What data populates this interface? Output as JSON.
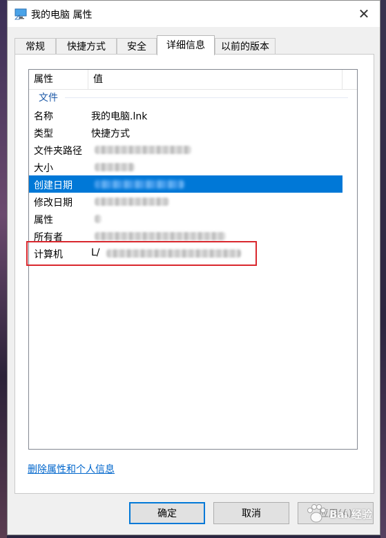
{
  "window": {
    "title": "我的电脑 属性",
    "close_glyph": "✕"
  },
  "tabs": [
    {
      "label": "常规"
    },
    {
      "label": "快捷方式"
    },
    {
      "label": "安全"
    },
    {
      "label": "详细信息"
    },
    {
      "label": "以前的版本"
    }
  ],
  "listview": {
    "col_property": "属性",
    "col_value": "值",
    "group_label": "文件",
    "rows": [
      {
        "key": "名称",
        "value": "我的电脑.lnk"
      },
      {
        "key": "类型",
        "value": "快捷方式"
      },
      {
        "key": "文件夹路径",
        "value": ""
      },
      {
        "key": "大小",
        "value": ""
      },
      {
        "key": "创建日期",
        "value": ""
      },
      {
        "key": "修改日期",
        "value": ""
      },
      {
        "key": "属性",
        "value": ""
      },
      {
        "key": "所有者",
        "value": ""
      },
      {
        "key": "计算机",
        "value": "L/"
      }
    ],
    "selected_row": "创建日期"
  },
  "remove_link": "删除属性和个人信息",
  "buttons": {
    "ok": "确定",
    "cancel": "取消",
    "apply": "应用(A)"
  },
  "watermark": {
    "text": "Bai 经验"
  },
  "colors": {
    "selection": "#0078d7",
    "link": "#0066cc",
    "highlight_box": "#d9262c",
    "group_text": "#1e5aa8"
  }
}
